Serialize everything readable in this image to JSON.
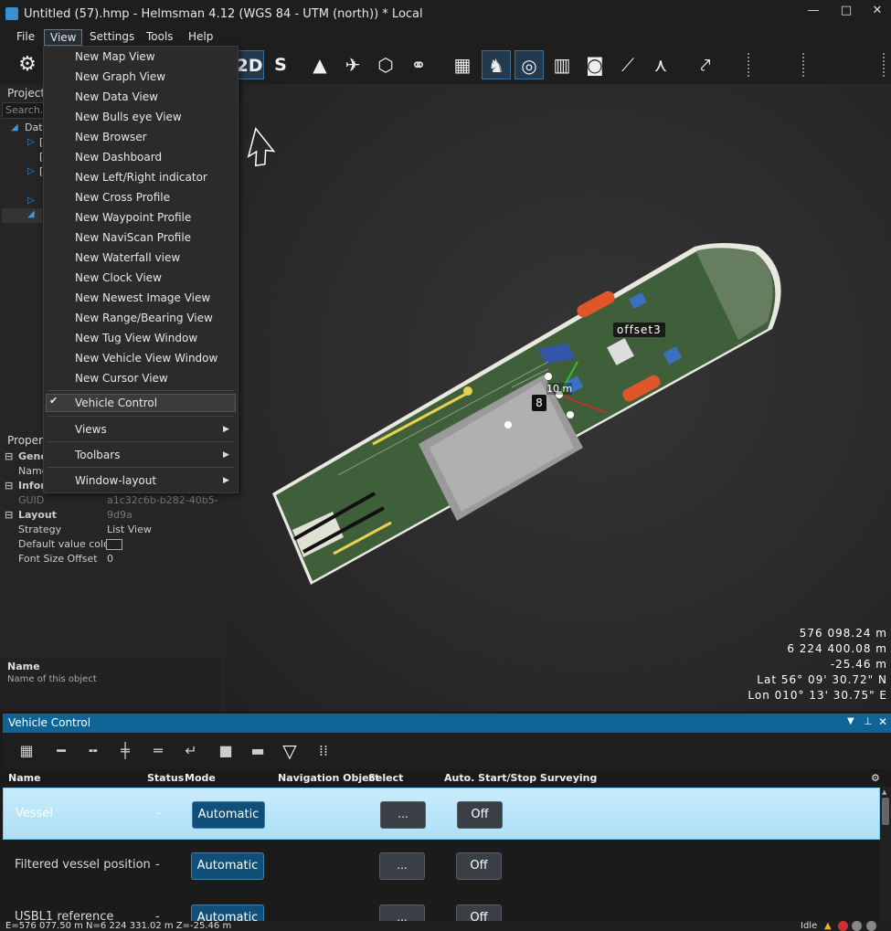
{
  "window": {
    "title": "Untitled (57).hmp - Helmsman 4.12 (WGS 84 - UTM (north)) * Local",
    "minimize": "—",
    "maximize": "□",
    "close": "✕"
  },
  "menubar": {
    "file": "File",
    "view": "View",
    "settings": "Settings",
    "tools": "Tools",
    "help": "Help"
  },
  "toolbar": {
    "label_2d": "2D",
    "label_s": "S"
  },
  "project": {
    "title": "Project",
    "search_placeholder": "Search...",
    "tree": [
      "Data",
      "[",
      "[",
      "["
    ]
  },
  "properties": {
    "title": "Propert",
    "rows": [
      {
        "section": true,
        "key": "Gene"
      },
      {
        "key": "Name",
        "value": ""
      },
      {
        "section": true,
        "key": "Infor"
      },
      {
        "key": "GUID",
        "value": "a1c32c6b-b282-40b5-9d9a"
      },
      {
        "section": true,
        "key": "Layout"
      },
      {
        "key": "Strategy",
        "value": "List View"
      },
      {
        "key": "Default value colou",
        "value": ""
      },
      {
        "key": "Font Size Offset",
        "value": "0"
      }
    ],
    "desc_title": "Name",
    "desc_text": "Name of this object"
  },
  "view_menu": {
    "items": [
      "New Map View",
      "New Graph View",
      "New Data View",
      "New Bulls eye View",
      "New Browser",
      "New Dashboard",
      "New Left/Right indicator",
      "New Cross Profile",
      "New Waypoint Profile",
      "New NaviScan Profile",
      "New Waterfall view",
      "New Clock View",
      "New Newest Image View",
      "New Range/Bearing View",
      "New Tug View Window",
      "New Vehicle View Window",
      "New Cursor View"
    ],
    "checked_item": "Vehicle Control",
    "check_mark": "✔",
    "submenus": [
      "Views",
      "Toolbars",
      "Window-layout"
    ]
  },
  "viewport": {
    "labels": {
      "offset": "offset3",
      "distance": "10 m",
      "number": "8"
    },
    "coords": [
      "576 098.24 m",
      "6 224 400.08 m",
      "-25.46 m",
      "Lat 56° 09' 30.72\" N",
      "Lon 010° 13' 30.75\" E"
    ]
  },
  "vehicle_control": {
    "title": "Vehicle Control",
    "columns": {
      "name": "Name",
      "status": "Status",
      "mode": "Mode",
      "nav": "Navigation Object",
      "select": "Select",
      "auto": "Auto. Start/Stop Surveying"
    },
    "rows": [
      {
        "name": "Vessel",
        "status": "-",
        "mode": "Automatic",
        "select": "...",
        "auto": "Off"
      },
      {
        "name": "Filtered vessel position",
        "status": "-",
        "mode": "Automatic",
        "select": "...",
        "auto": "Off"
      },
      {
        "name": "USBL1 reference",
        "status": "-",
        "mode": "Automatic",
        "select": "...",
        "auto": "Off"
      }
    ]
  },
  "statusbar": {
    "left": "E=576 077.50 m N=6 224 331.02 m Z=-25.46 m",
    "right": "Idle"
  },
  "colors": {
    "accent": "#0f6496",
    "selected_row": "#c8ebfb",
    "hull": "#3f5f3a"
  }
}
